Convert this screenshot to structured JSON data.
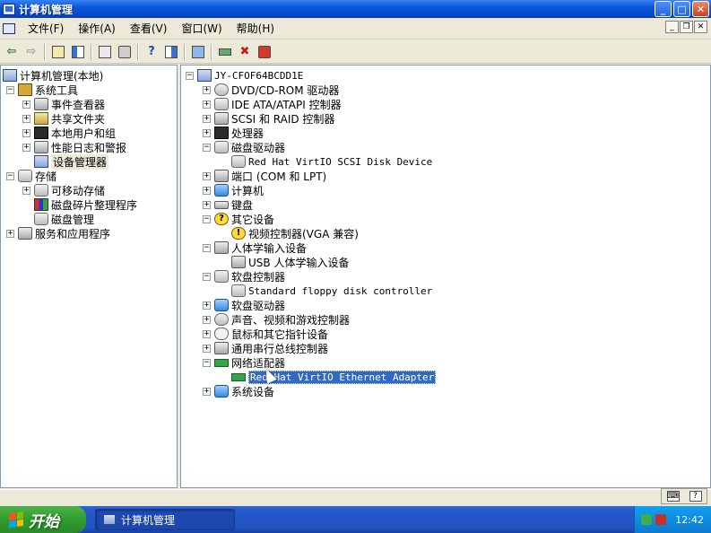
{
  "window": {
    "title": "计算机管理"
  },
  "menu": {
    "items": [
      "文件(F)",
      "操作(A)",
      "查看(V)",
      "窗口(W)",
      "帮助(H)"
    ]
  },
  "toolbar": {
    "buttons": [
      "back-icon",
      "forward-icon",
      "up-icon",
      "show-hide-tree-icon",
      "properties-icon",
      "print-icon",
      "help-icon",
      "view-icon",
      "scan-icon",
      "update-driver-icon",
      "uninstall-icon",
      "disable-icon"
    ]
  },
  "left_tree": {
    "root": "计算机管理(本地)",
    "system_tools": "系统工具",
    "event_viewer": "事件查看器",
    "shared_folders": "共享文件夹",
    "local_users": "本地用户和组",
    "perf_logs": "性能日志和警报",
    "device_manager": "设备管理器",
    "storage": "存储",
    "removable_storage": "可移动存储",
    "defrag": "磁盘碎片整理程序",
    "disk_management": "磁盘管理",
    "services": "服务和应用程序"
  },
  "device_tree": {
    "computer_name": "JY-CFOF64BCDD1E",
    "dvd": "DVD/CD-ROM 驱动器",
    "ide": "IDE ATA/ATAPI 控制器",
    "scsi": "SCSI 和 RAID 控制器",
    "processor": "处理器",
    "disk_drives": "磁盘驱动器",
    "disk_device": "Red Hat VirtIO SCSI Disk Device",
    "ports": "端口 (COM 和 LPT)",
    "computer": "计算机",
    "keyboard": "键盘",
    "other": "其它设备",
    "video_controller": "视频控制器(VGA 兼容)",
    "hid": "人体学输入设备",
    "usb_hid": "USB 人体学输入设备",
    "floppy_ctrl": "软盘控制器",
    "floppy_ctrl_device": "Standard floppy disk controller",
    "floppy_drive": "软盘驱动器",
    "sound": "声音、视频和游戏控制器",
    "mouse": "鼠标和其它指针设备",
    "usb": "通用串行总线控制器",
    "network": "网络适配器",
    "network_device": "Red Hat VirtIO Ethernet Adapter",
    "system": "系统设备"
  },
  "taskbar": {
    "start": "开始",
    "task_label": "计算机管理",
    "clock": "12:42"
  },
  "colors": {
    "titlebar": "#0a58dd",
    "selection": "#316ac5",
    "start": "#2f9c2d",
    "tray": "#0e8ce0"
  }
}
